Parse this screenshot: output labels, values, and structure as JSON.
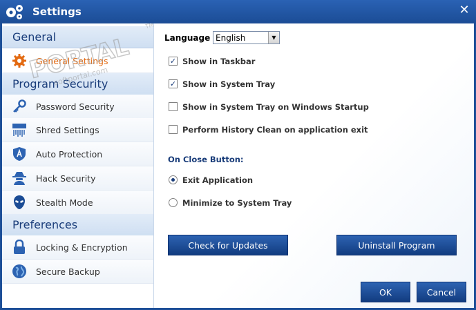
{
  "window": {
    "title": "Settings",
    "close_glyph": "✕"
  },
  "sidebar": {
    "sections": [
      {
        "label": "General"
      },
      {
        "label": "Program Security"
      },
      {
        "label": "Preferences"
      }
    ],
    "items": [
      {
        "label": "General Settings",
        "icon": "gear-icon",
        "active": true
      },
      {
        "label": "Password Security",
        "icon": "key-icon"
      },
      {
        "label": "Shred Settings",
        "icon": "shredder-icon"
      },
      {
        "label": "Auto Protection",
        "icon": "shield-icon"
      },
      {
        "label": "Hack Security",
        "icon": "hacker-icon"
      },
      {
        "label": "Stealth Mode",
        "icon": "alien-mask-icon"
      },
      {
        "label": "Locking & Encryption",
        "icon": "lock-icon"
      },
      {
        "label": "Secure Backup",
        "icon": "globe-icon"
      }
    ]
  },
  "general": {
    "language_label": "Language",
    "language_value": "English",
    "options": [
      {
        "label": "Show in Taskbar",
        "checked": true
      },
      {
        "label": "Show in System Tray",
        "checked": true
      },
      {
        "label": "Show in System Tray on Windows Startup",
        "checked": false
      },
      {
        "label": "Perform History Clean on application exit",
        "checked": false
      }
    ],
    "close_heading": "On Close Button:",
    "close_options": [
      {
        "label": "Exit Application",
        "selected": true
      },
      {
        "label": "Minimize to System Tray",
        "selected": false
      }
    ]
  },
  "buttons": {
    "check_updates": "Check for Updates",
    "uninstall": "Uninstall Program",
    "ok": "OK",
    "cancel": "Cancel"
  },
  "watermark": {
    "text": "PORTAL",
    "sub": "softportal.com",
    "tm": "TM"
  },
  "colors": {
    "accent": "#1d4f98",
    "active_item": "#e36a12",
    "heading": "#1a3d7a"
  }
}
